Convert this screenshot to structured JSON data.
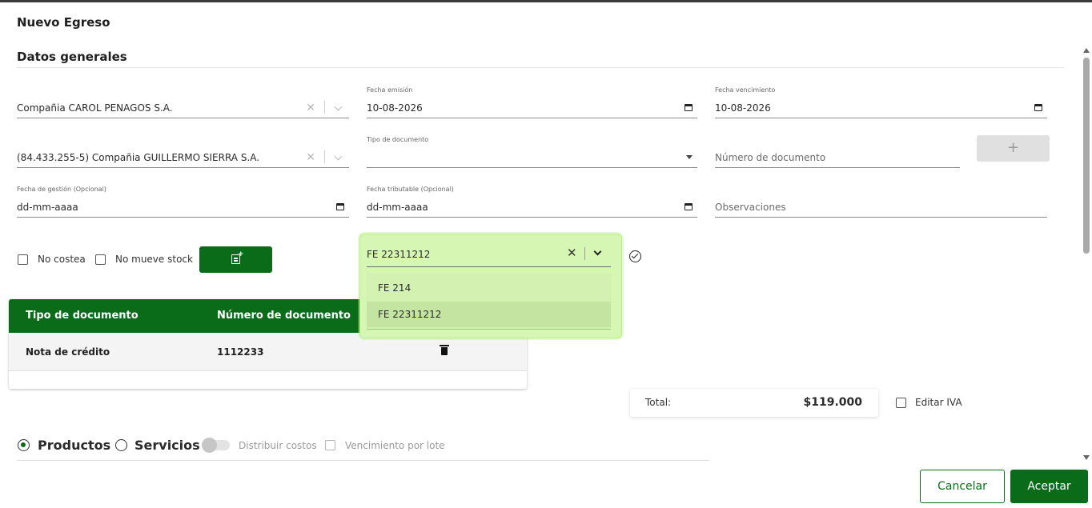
{
  "header": {
    "title": "Nuevo Egreso",
    "section": "Datos generales"
  },
  "form": {
    "company": {
      "value": "Compañia CAROL PENAGOS S.A."
    },
    "fecha_emision": {
      "label": "Fecha emisión",
      "value": "10-08-2026"
    },
    "fecha_vencimiento": {
      "label": "Fecha vencimiento",
      "value": "10-08-2026"
    },
    "supplier": {
      "value": "(84.433.255-5) Compañia GUILLERMO SIERRA S.A."
    },
    "tipo_documento": {
      "label": "Tipo de documento",
      "value": ""
    },
    "numero_documento": {
      "placeholder": "Número de documento"
    },
    "add_button": {
      "label": "+"
    },
    "fecha_gestion": {
      "label": "Fecha de gestión (Opcional)",
      "value": "dd-mm-aaaa"
    },
    "fecha_tributable": {
      "label": "Fecha tributable (Opcional)",
      "value": "dd-mm-aaaa"
    },
    "observaciones": {
      "placeholder": "Observaciones"
    },
    "no_costea": {
      "label": "No costea",
      "checked": false
    },
    "no_mueve_stock": {
      "label": "No mueve stock",
      "checked": false
    },
    "add_doc_icon": "add-document-icon"
  },
  "doc_select": {
    "value": "FE 22311212",
    "options": [
      "FE 214",
      "FE 22311212"
    ],
    "selected_index": 1
  },
  "doc_table": {
    "columns": [
      "Tipo de documento",
      "Número de documento"
    ],
    "rows": [
      {
        "tipo": "Nota de crédito",
        "numero": "1112233"
      }
    ]
  },
  "totals": {
    "label": "Total:",
    "value": "$119.000",
    "editar_iva_label": "Editar IVA"
  },
  "items_tabs": {
    "productos": "Productos",
    "servicios": "Servicios",
    "selected": "Productos",
    "distribuir_costos": "Distribuir costos",
    "vencimiento_por_lote": "Vencimiento por lote"
  },
  "actions": {
    "cancel": "Cancelar",
    "accept": "Aceptar"
  },
  "colors": {
    "primary": "#0a6b18",
    "highlight": "#d6f7b4"
  }
}
